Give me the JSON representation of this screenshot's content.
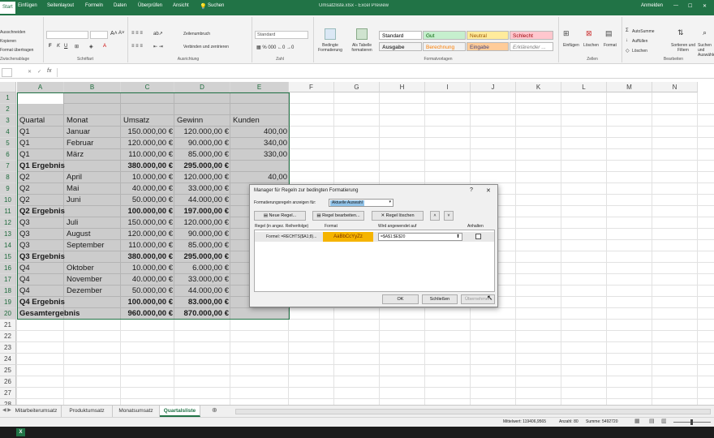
{
  "titlebar": {
    "doc_title": "Umsatzliste.xlsx - Excel Preview",
    "user": "Anmelden",
    "menus": [
      "Start",
      "Einfügen",
      "Seitenlayout",
      "Formeln",
      "Daten",
      "Überprüfen",
      "Ansicht",
      "Suchen"
    ],
    "accent": "#217346"
  },
  "ribbon": {
    "clipboard": [
      "Ausschneiden",
      "Kopieren",
      "Format übertragen"
    ],
    "merge_label": "Verbinden und zentrieren",
    "wrap_label": "Zeilenumbruch",
    "number_format": "Standard",
    "cond_format": "Bedingte Formatierung",
    "as_table": "Als Tabelle formatieren",
    "styles": [
      {
        "label": "Standard",
        "bg": "#ffffff",
        "fg": "#000000"
      },
      {
        "label": "Gut",
        "bg": "#c6efce",
        "fg": "#006100"
      },
      {
        "label": "Neutral",
        "bg": "#ffeb9c",
        "fg": "#9c5700"
      },
      {
        "label": "Schlecht",
        "bg": "#ffc7ce",
        "fg": "#9c0006"
      },
      {
        "label": "Ausgabe",
        "bg": "#f2f2f2",
        "fg": "#3f3f3f"
      },
      {
        "label": "Berechnung",
        "bg": "#f2f2f2",
        "fg": "#fa7d00"
      },
      {
        "label": "Eingabe",
        "bg": "#ffcc99",
        "fg": "#3f3f76"
      },
      {
        "label": "Erklärender ...",
        "bg": "#ffffff",
        "fg": "#7f7f7f"
      }
    ],
    "cells_buttons": [
      "Einfügen",
      "Löschen",
      "Format"
    ],
    "editing": [
      "AutoSumme",
      "Auffüllen",
      "Löschen"
    ],
    "sort_label": "Sortieren und Filtern",
    "find_label": "Suchen und Auswählen",
    "groups": [
      "Zwischenablage",
      "Schriftart",
      "Ausrichtung",
      "Zahl",
      "Formatvorlagen",
      "Zellen",
      "Bearbeiten"
    ]
  },
  "formula_bar": {
    "fx": "fx",
    "value": ""
  },
  "columns": [
    "A",
    "B",
    "C",
    "D",
    "E",
    "F",
    "G",
    "H",
    "I",
    "J",
    "K",
    "L",
    "M",
    "N"
  ],
  "rows": [
    [
      "",
      "",
      "",
      "",
      ""
    ],
    [
      "",
      "",
      "",
      "",
      ""
    ],
    [
      "Quartal",
      "Monat",
      "Umsatz",
      "Gewinn",
      "Kunden"
    ],
    [
      "Q1",
      "Januar",
      "150.000,00 €",
      "120.000,00 €",
      "400,00"
    ],
    [
      "Q1",
      "Februar",
      "120.000,00 €",
      "90.000,00 €",
      "340,00"
    ],
    [
      "Q1",
      "März",
      "110.000,00 €",
      "85.000,00 €",
      "330,00"
    ],
    [
      "Q1 Ergebnis",
      "",
      "380.000,00 €",
      "295.000,00 €",
      ""
    ],
    [
      "Q2",
      "April",
      "10.000,00 €",
      "120.000,00 €",
      "40,00"
    ],
    [
      "Q2",
      "Mai",
      "40.000,00 €",
      "33.000,00 €",
      ""
    ],
    [
      "Q2",
      "Juni",
      "50.000,00 €",
      "44.000,00 €",
      ""
    ],
    [
      "Q2 Ergebnis",
      "",
      "100.000,00 €",
      "197.000,00 €",
      ""
    ],
    [
      "Q3",
      "Juli",
      "150.000,00 €",
      "120.000,00 €",
      ""
    ],
    [
      "Q3",
      "August",
      "120.000,00 €",
      "90.000,00 €",
      ""
    ],
    [
      "Q3",
      "September",
      "110.000,00 €",
      "85.000,00 €",
      ""
    ],
    [
      "Q3 Ergebnis",
      "",
      "380.000,00 €",
      "295.000,00 €",
      ""
    ],
    [
      "Q4",
      "Oktober",
      "10.000,00 €",
      "6.000,00 €",
      ""
    ],
    [
      "Q4",
      "November",
      "40.000,00 €",
      "33.000,00 €",
      ""
    ],
    [
      "Q4",
      "Dezember",
      "50.000,00 €",
      "44.000,00 €",
      ""
    ],
    [
      "Q4 Ergebnis",
      "",
      "100.000,00 €",
      "83.000,00 €",
      ""
    ],
    [
      "Gesamtergebnis",
      "",
      "960.000,00 €",
      "870.000,00 €",
      ""
    ]
  ],
  "bold_rows": [
    7,
    11,
    15,
    19,
    20
  ],
  "dialog": {
    "title": "Manager für Regeln zur bedingten Formatierung",
    "help": "?",
    "close": "✕",
    "show_label": "Formatierungsregeln anzeigen für:",
    "show_value": "Aktuelle Auswahl",
    "new_rule": "Neue Regel...",
    "edit_rule": "Regel bearbeiten...",
    "delete_rule": "Regel löschen",
    "col_rule": "Regel (in angez. Reihenfolge)",
    "col_format": "Format",
    "col_applies": "Wird angewendet auf",
    "col_stop": "Anhalten",
    "rule_text": "Formel: =RECHTS($A1;8)...",
    "preview": "AaBbCcYyZz",
    "preview_bg": "#f5b400",
    "applies_to": "=$A$1:$E$20",
    "ok": "OK",
    "close_btn": "Schließen",
    "apply": "Übernehmen"
  },
  "sheet_tabs": [
    "Mitarbeiterumsatz",
    "Produktumsatz",
    "Monatsumsatz",
    "Quartalsliste"
  ],
  "active_tab": "Quartalsliste",
  "status": {
    "avg": "Mittelwert: 119406,9565",
    "count": "Anzahl: 80",
    "sum": "Summe: 5492720"
  }
}
